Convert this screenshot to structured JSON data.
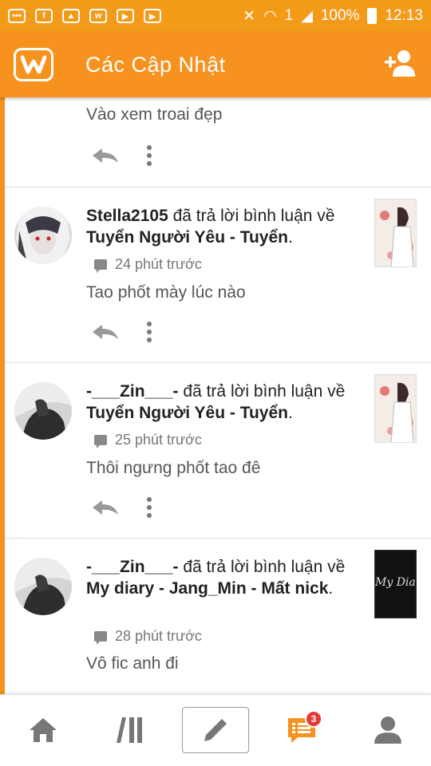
{
  "status_bar": {
    "battery": "100%",
    "time": "12:13"
  },
  "app_bar": {
    "title": "Các Cập Nhật"
  },
  "feed": {
    "items": [
      {
        "message": "Vào xem troai đẹp"
      },
      {
        "user": "Stella2105",
        "action": "đã trả lời bình luận về",
        "story": "Tuyển Người Yêu - Tuyển",
        "time": "24 phút trước",
        "message": "Tao phốt mày lúc nào"
      },
      {
        "user": "-___Zin___-",
        "action": "đã trả lời bình luận về",
        "story": "Tuyển Người Yêu - Tuyển",
        "time": "25 phút trước",
        "message": "Thôi ngưng phốt tao đê"
      },
      {
        "user": "-___Zin___-",
        "action": "đã trả lời bình luận về",
        "story": "My diary - Jang_Min - Mất nick",
        "time": "28 phút trước",
        "message": "Vô fic anh đi",
        "thumb_text": "My Diary"
      }
    ]
  },
  "bottom_nav": {
    "notifications_badge": "3"
  },
  "colors": {
    "accent": "#f7921e",
    "status_bar": "#f49a19",
    "badge": "#e53935",
    "icon_grey": "#777777"
  }
}
